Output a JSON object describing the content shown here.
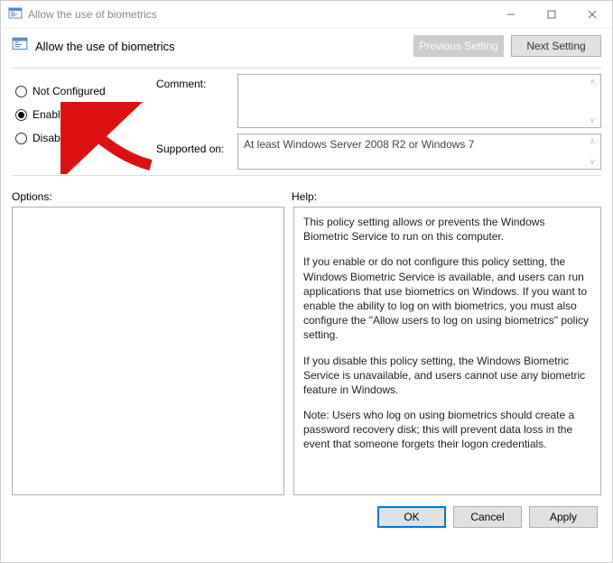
{
  "window": {
    "title": "Allow the use of biometrics"
  },
  "header": {
    "policy_title": "Allow the use of biometrics",
    "previous_label": "Previous Setting",
    "next_label": "Next Setting"
  },
  "radios": {
    "not_configured": "Not Configured",
    "enabled": "Enabled",
    "disabled": "Disabled",
    "selected": "enabled"
  },
  "fields": {
    "comment_label": "Comment:",
    "comment_value": "",
    "supported_label": "Supported on:",
    "supported_value": "At least Windows Server 2008 R2 or Windows 7"
  },
  "sections": {
    "options_label": "Options:",
    "help_label": "Help:"
  },
  "help": {
    "p1": "This policy setting allows or prevents the Windows Biometric Service to run on this computer.",
    "p2": "If you enable or do not configure this policy setting, the Windows Biometric Service is available, and users can run applications that use biometrics on Windows. If you want to enable the ability to log on with biometrics, you must also configure the \"Allow users to log on using biometrics\" policy setting.",
    "p3": "If you disable this policy setting, the Windows Biometric Service is unavailable, and users cannot use any biometric feature in Windows.",
    "p4": "Note: Users who log on using biometrics should create a password recovery disk; this will prevent data loss in the event that someone forgets their logon credentials."
  },
  "footer": {
    "ok": "OK",
    "cancel": "Cancel",
    "apply": "Apply"
  }
}
